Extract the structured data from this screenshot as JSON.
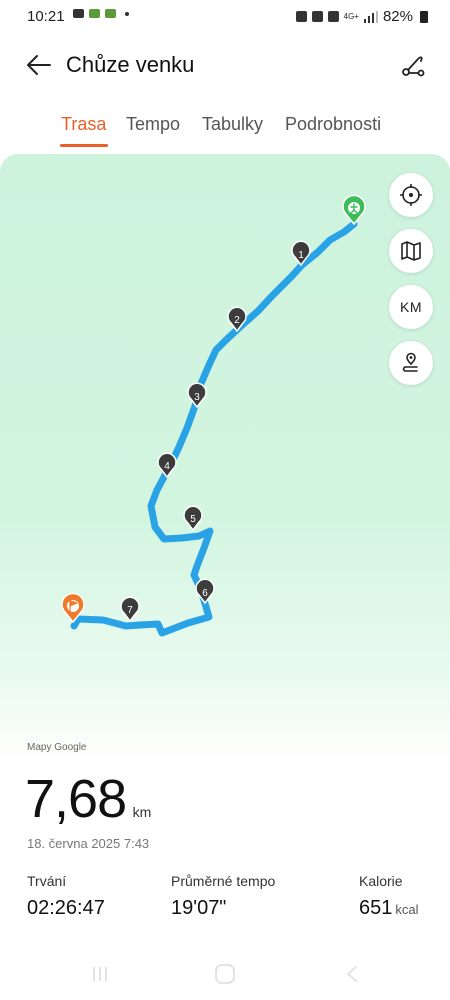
{
  "status_bar": {
    "time": "10:21",
    "network": "4G+",
    "battery": "82%"
  },
  "header": {
    "title": "Chůze venku",
    "back_icon": "arrow-left-icon",
    "route_icon": "route-icon"
  },
  "tabs": [
    {
      "label": "Trasa",
      "active": true
    },
    {
      "label": "Tempo",
      "active": false
    },
    {
      "label": "Tabulky",
      "active": false
    },
    {
      "label": "Podrobnosti",
      "active": false
    }
  ],
  "map": {
    "attribution": "Mapy Google",
    "controls": [
      {
        "name": "locate-icon"
      },
      {
        "name": "map-icon"
      },
      {
        "name": "km-toggle",
        "label": "KM"
      },
      {
        "name": "waypoint-icon"
      }
    ],
    "km_markers": [
      "1",
      "2",
      "3",
      "4",
      "5",
      "6",
      "7"
    ],
    "colors": {
      "route": "#2aa3e6",
      "start": "#3cbd5a",
      "finish": "#f07a2a",
      "background": "#cdf3dd"
    }
  },
  "summary": {
    "distance": "7,68",
    "distance_unit": "km",
    "date": "18. června 2025 7:43"
  },
  "stats": [
    {
      "label": "Trvání",
      "value": "02:26:47",
      "unit": ""
    },
    {
      "label": "Průměrné tempo",
      "value": "19'07\"",
      "unit": ""
    },
    {
      "label": "Kalorie",
      "value": "651",
      "unit": "kcal"
    }
  ],
  "accent_color": "#e8602a"
}
